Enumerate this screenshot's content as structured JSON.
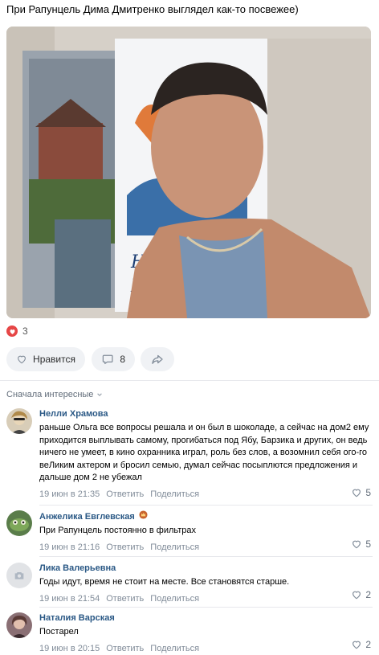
{
  "post": {
    "text": "При Рапунцель Дима Дмитренко выглядел как-то посвежее)",
    "reaction_count": "3",
    "like_label": "Нравится",
    "comment_count": "8"
  },
  "comments_header": {
    "sort_label": "Сначала интересные"
  },
  "comments": [
    {
      "author": "Нелли Храмова",
      "text": "раньше Ольга все вопросы решала и он был в шоколаде, а сейчас на дом2 ему приходится выплывать самому, прогибаться под Ябу, Барзика и других, он ведь ничего не умеет, в кино охранника играл, роль без слов, а возомнил себя ого-го веЛиким актером и бросил семью, думал сейчас посыплются предложения и дальше дом 2 не убежал",
      "date": "19 июн в 21:35",
      "reply": "Ответить",
      "share": "Поделиться",
      "likes": "5"
    },
    {
      "author": "Анжелика Евглевская",
      "text": "При Рапунцель постоянно в фильтрах",
      "date": "19 июн в 21:16",
      "reply": "Ответить",
      "share": "Поделиться",
      "likes": "5"
    },
    {
      "author": "Лика Валерьевна",
      "text": "Годы идут, время не стоит на месте. Все становятся старше.",
      "date": "19 июн в 21:54",
      "reply": "Ответить",
      "share": "Поделиться",
      "likes": "2"
    },
    {
      "author": "Наталия Варская",
      "text": "Постарел",
      "date": "19 июн в 20:15",
      "reply": "Ответить",
      "share": "Поделиться",
      "likes": "2"
    }
  ],
  "colors": {
    "link": "#2a5885",
    "meta": "#818c99",
    "button_bg": "#f0f2f5",
    "reaction_heart": "#e64646"
  },
  "icons": {
    "reaction": "heart-icon",
    "like": "heart-outline-icon",
    "comment": "comment-bubble-icon",
    "share": "share-arrow-icon",
    "sort": "chevron-down-icon",
    "comment_like": "heart-outline-icon",
    "camera": "camera-icon"
  }
}
